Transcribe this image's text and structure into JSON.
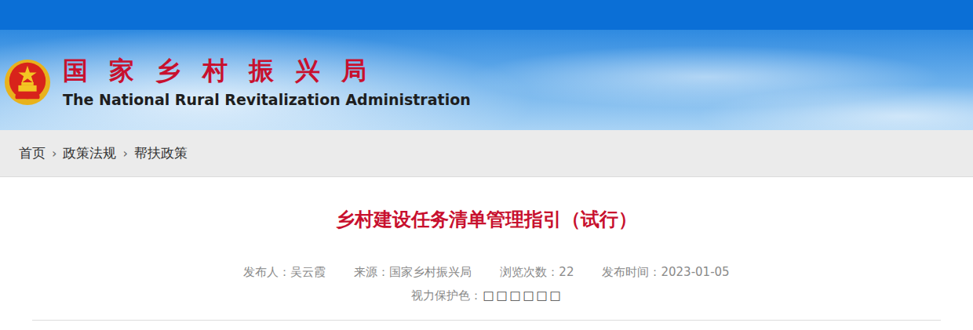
{
  "site": {
    "title": "国家乡村振兴局",
    "subtitle": "The National Rural Revitalization Administration"
  },
  "breadcrumb": {
    "items": [
      "首页",
      "政策法规",
      "帮扶政策"
    ],
    "separator": "›"
  },
  "article": {
    "title": "乡村建设任务清单管理指引（试行）",
    "meta": [
      {
        "label": "发布人：",
        "value": "吴云霞"
      },
      {
        "label": "来源：",
        "value": "国家乡村振兴局"
      },
      {
        "label": "浏览次数：",
        "value": "22"
      },
      {
        "label": "发布时间：",
        "value": "2023-01-05"
      }
    ],
    "eye_care": {
      "label": "视力保护色：",
      "swatches": [
        "□",
        "□",
        "□",
        "□",
        "□",
        "□"
      ]
    }
  }
}
